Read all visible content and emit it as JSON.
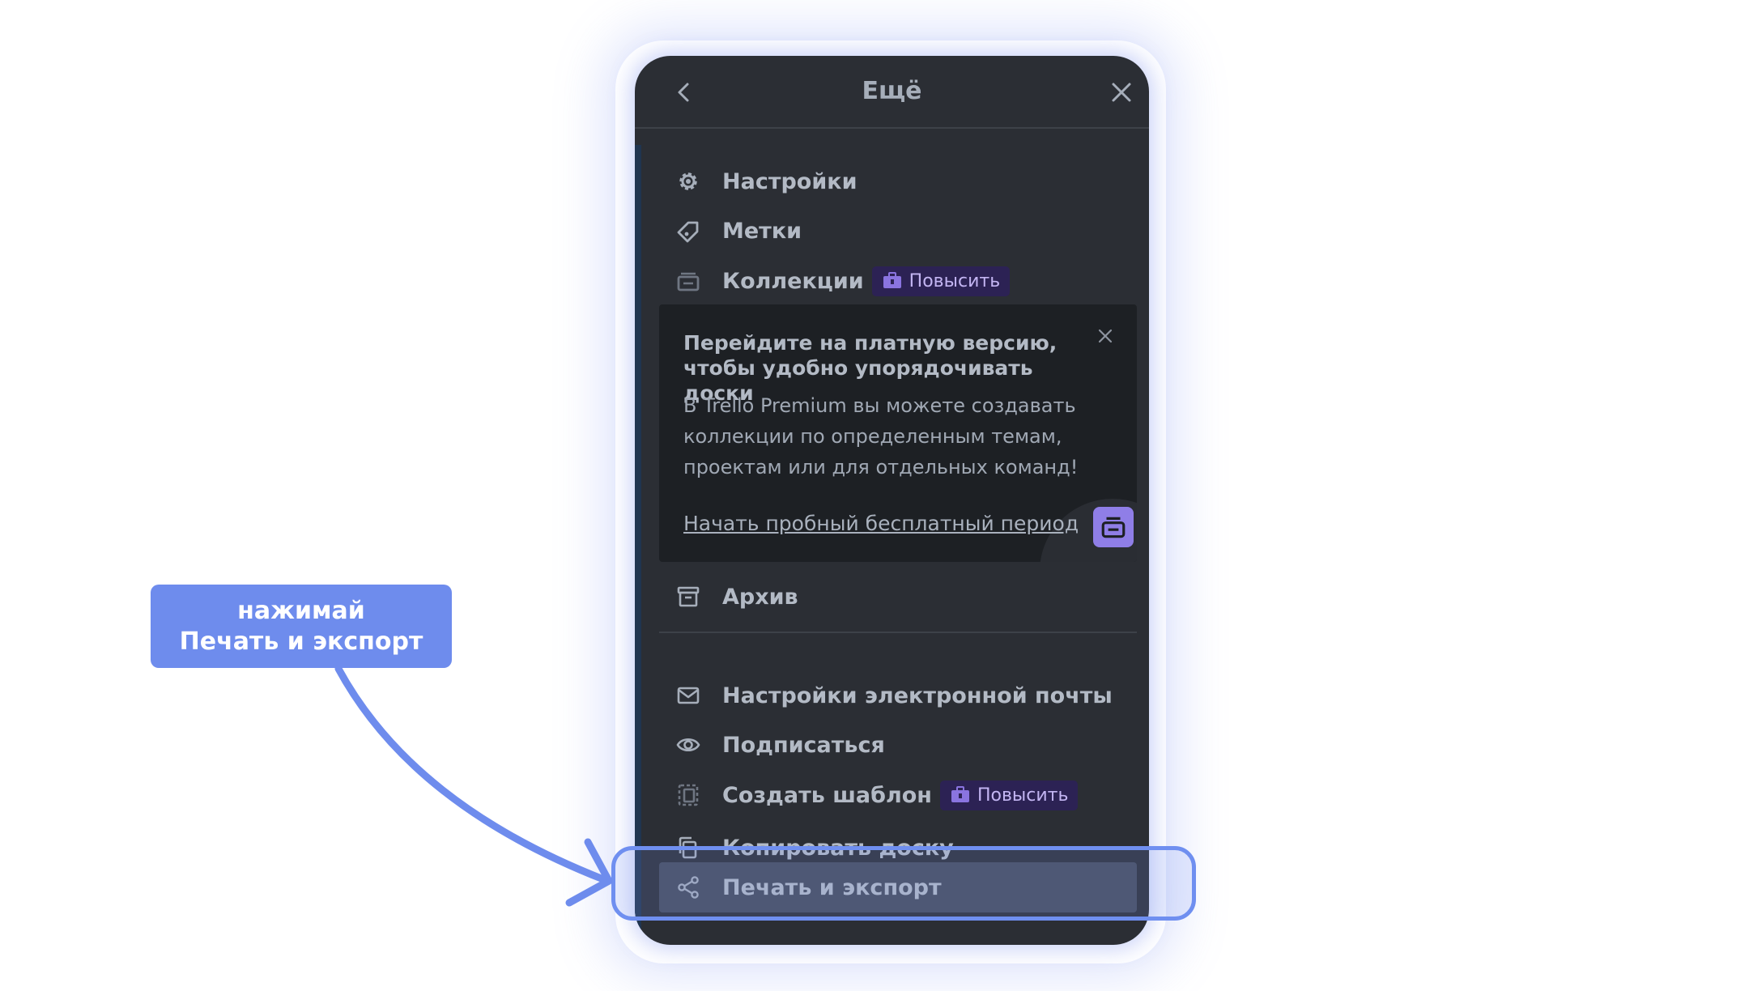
{
  "panel": {
    "title": "Ещё"
  },
  "menu_top": [
    {
      "icon": "gear-icon",
      "label": "Настройки"
    },
    {
      "icon": "tag-icon",
      "label": "Метки"
    },
    {
      "icon": "collections-icon",
      "label": "Коллекции",
      "badge": "Повысить"
    }
  ],
  "promo": {
    "title": "Перейдите на платную версию, чтобы удобно упорядочивать доски",
    "text": "В Trello Premium вы можете создавать коллекции по определенным темам, проектам или для отдельных команд!",
    "link": "Начать пробный бесплатный период"
  },
  "menu_archive": {
    "icon": "archive-icon",
    "label": "Архив"
  },
  "menu_bottom": [
    {
      "icon": "mail-icon",
      "label": "Настройки электронной почты"
    },
    {
      "icon": "eye-icon",
      "label": "Подписаться"
    },
    {
      "icon": "template-icon",
      "label": "Создать шаблон",
      "badge": "Повысить"
    },
    {
      "icon": "copy-icon",
      "label": "Копировать доску"
    },
    {
      "icon": "share-icon",
      "label": "Печать и экспорт"
    }
  ],
  "callout": {
    "line1": "нажимай",
    "line2": "Печать и экспорт"
  },
  "colors": {
    "panel_bg": "#2b2e34",
    "accent": "#6e8ced",
    "badge_bg": "#2c2254",
    "highlight": "#454b59"
  }
}
